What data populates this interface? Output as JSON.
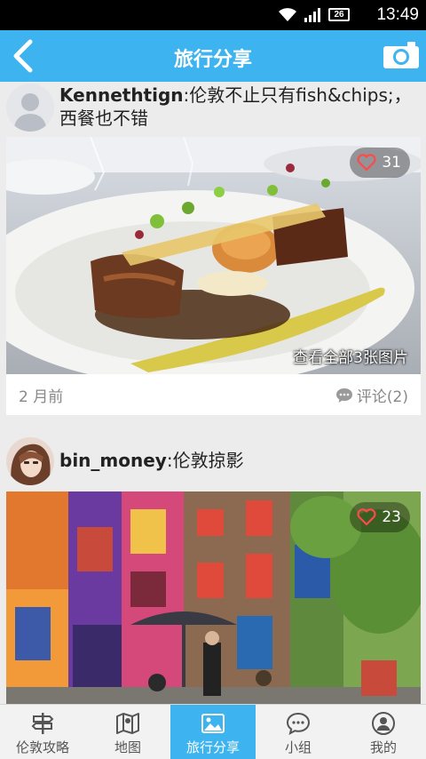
{
  "status_bar": {
    "time": "13:49",
    "battery": "26"
  },
  "header": {
    "title": "旅行分享"
  },
  "posts": [
    {
      "user": "Kennethtign",
      "text": ":伦敦不止只有fish&chips;，西餐也不错",
      "likes": "31",
      "view_all": "查看全部3张图片",
      "time_ago": "2 月前",
      "comments": "评论(2)"
    },
    {
      "user": "bin_money",
      "text": ":伦敦掠影",
      "likes": "23"
    }
  ],
  "tabs": [
    {
      "label": "伦敦攻略",
      "icon": "signpost-icon"
    },
    {
      "label": "地图",
      "icon": "map-icon"
    },
    {
      "label": "旅行分享",
      "icon": "photo-icon",
      "active": true
    },
    {
      "label": "小组",
      "icon": "chat-bubble-icon"
    },
    {
      "label": "我的",
      "icon": "profile-icon"
    }
  ],
  "colors": {
    "accent": "#3db4f0",
    "heart": "#ff4a4a"
  }
}
